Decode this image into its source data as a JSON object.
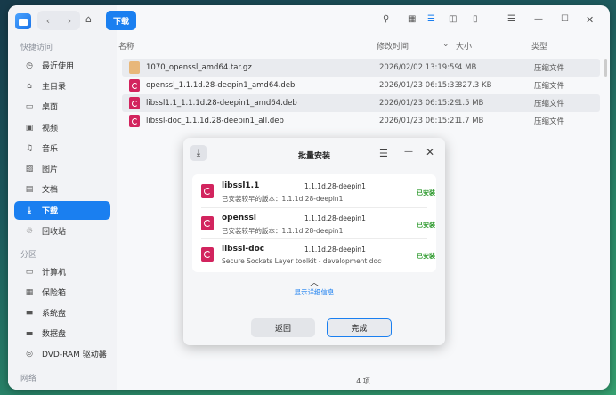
{
  "sidebar": {
    "quick_access_label": "快捷访问",
    "items": [
      {
        "label": "最近使用",
        "icon": "clock-icon"
      },
      {
        "label": "主目录",
        "icon": "home-icon"
      },
      {
        "label": "桌面",
        "icon": "desktop-icon"
      },
      {
        "label": "视频",
        "icon": "video-icon"
      },
      {
        "label": "音乐",
        "icon": "music-icon"
      },
      {
        "label": "图片",
        "icon": "image-icon"
      },
      {
        "label": "文档",
        "icon": "document-icon"
      },
      {
        "label": "下载",
        "icon": "download-icon"
      },
      {
        "label": "回收站",
        "icon": "trash-icon"
      }
    ],
    "partitions_label": "分区",
    "devices": [
      {
        "label": "计算机",
        "icon": "computer-icon"
      },
      {
        "label": "保险箱",
        "icon": "vault-icon"
      },
      {
        "label": "系统盘",
        "icon": "drive-icon"
      },
      {
        "label": "数据盘",
        "icon": "drive-icon"
      },
      {
        "label": "DVD-RAM 驱动器",
        "icon": "optical-drive-icon"
      }
    ],
    "network_label": "网络"
  },
  "toolbar": {
    "current_folder": "下载"
  },
  "columns": {
    "name": "名称",
    "modified": "修改时间",
    "size": "大小",
    "type": "类型"
  },
  "files": [
    {
      "name": "1070_openssl_amd64.tar.gz",
      "modified": "2026/02/02 13:19:59",
      "size": "4 MB",
      "type": "压缩文件",
      "kind": "tgz"
    },
    {
      "name": "openssl_1.1.1d.28-deepin1_amd64.deb",
      "modified": "2026/01/23 06:15:33",
      "size": "827.3 KB",
      "type": "压缩文件",
      "kind": "deb"
    },
    {
      "name": "libssl1.1_1.1.1d.28-deepin1_amd64.deb",
      "modified": "2026/01/23 06:15:29",
      "size": "1.5 MB",
      "type": "压缩文件",
      "kind": "deb"
    },
    {
      "name": "libssl-doc_1.1.1d.28-deepin1_all.deb",
      "modified": "2026/01/23 06:15:21",
      "size": "1.7 MB",
      "type": "压缩文件",
      "kind": "deb"
    }
  ],
  "status_bar": "4 项",
  "dialog": {
    "title": "批量安装",
    "packages": [
      {
        "name": "libssl1.1",
        "version": "1.1.1d.28-deepin1",
        "desc": "已安装较早的版本：1.1.1d.28-deepin1",
        "status": "已安装"
      },
      {
        "name": "openssl",
        "version": "1.1.1d.28-deepin1",
        "desc": "已安装较早的版本：1.1.1d.28-deepin1",
        "status": "已安装"
      },
      {
        "name": "libssl-doc",
        "version": "1.1.1d.28-deepin1",
        "desc": "Secure Sockets Layer toolkit - development docume…",
        "status": "已安装"
      }
    ],
    "details_label": "显示详细信息",
    "back_label": "返回",
    "done_label": "完成"
  }
}
